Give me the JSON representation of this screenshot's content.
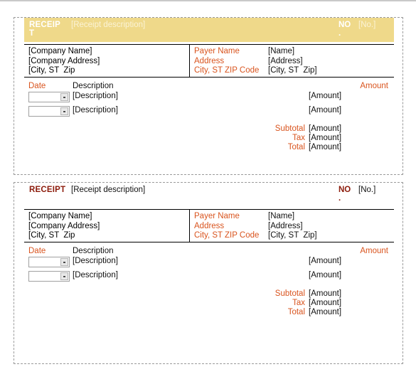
{
  "document": {
    "receipts": [
      {
        "style": "highlighted",
        "title_line1": "RECEIP",
        "title_line2": "T",
        "description": "[Receipt description]",
        "no_line1": "NO",
        "no_line2": ".",
        "no_value": "[No.]",
        "company": [
          "[Company Name]",
          "[Company Address]",
          "[City, ST  Zip"
        ],
        "payer_labels": [
          "Payer Name",
          "Address",
          "City, ST ZIP Code"
        ],
        "payer_values": [
          "[Name]",
          "[Address]",
          "[City, ST  Zip]"
        ],
        "columns": {
          "date": "Date",
          "description": "Description",
          "amount": "Amount"
        },
        "rows": [
          {
            "date": "",
            "description": "[Description]",
            "amount": "[Amount]"
          },
          {
            "date": "",
            "description": "[Description]",
            "amount": "[Amount]"
          }
        ],
        "totals": [
          {
            "label": "Subtotal",
            "value": "[Amount]"
          },
          {
            "label": "Tax",
            "value": "[Amount]"
          },
          {
            "label": "Total",
            "value": "[Amount]"
          }
        ]
      },
      {
        "style": "plain",
        "title_line1": "RECEIPT",
        "title_line2": "",
        "description": "[Receipt description]",
        "no_line1": "NO",
        "no_line2": ".",
        "no_value": "[No.]",
        "company": [
          "[Company Name]",
          "[Company Address]",
          "[City, ST  Zip"
        ],
        "payer_labels": [
          "Payer Name",
          "Address",
          "City, ST ZIP Code"
        ],
        "payer_values": [
          "[Name]",
          "[Address]",
          "[City, ST  Zip]"
        ],
        "columns": {
          "date": "Date",
          "description": "Description",
          "amount": "Amount"
        },
        "rows": [
          {
            "date": "",
            "description": "[Description]",
            "amount": "[Amount]"
          },
          {
            "date": "",
            "description": "[Description]",
            "amount": "[Amount]"
          }
        ],
        "totals": [
          {
            "label": "Subtotal",
            "value": "[Amount]"
          },
          {
            "label": "Tax",
            "value": "[Amount]"
          },
          {
            "label": "Total",
            "value": "[Amount]"
          }
        ]
      }
    ],
    "colors": {
      "header_band": "#efd98a",
      "accent_orange": "#d9541e",
      "accent_dark_red": "#8c1b0b",
      "cut_line": "#9a9a9a"
    }
  }
}
